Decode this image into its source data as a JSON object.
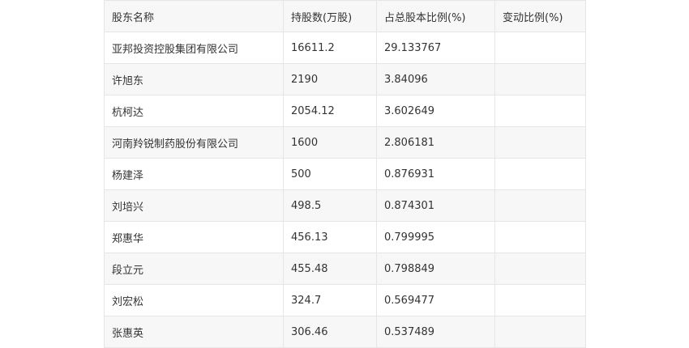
{
  "table": {
    "headers": [
      "股东名称",
      "持股数(万股)",
      "占总股本比例(%)",
      "变动比例(%)"
    ],
    "rows": [
      [
        "亚邦投资控股集团有限公司",
        "16611.2",
        "29.133767",
        ""
      ],
      [
        "许旭东",
        "2190",
        "3.84096",
        ""
      ],
      [
        "杭柯达",
        "2054.12",
        "3.602649",
        ""
      ],
      [
        "河南羚锐制药股份有限公司",
        "1600",
        "2.806181",
        ""
      ],
      [
        "杨建泽",
        "500",
        "0.876931",
        ""
      ],
      [
        "刘培兴",
        "498.5",
        "0.874301",
        ""
      ],
      [
        "郑惠华",
        "456.13",
        "0.799995",
        ""
      ],
      [
        "段立元",
        "455.48",
        "0.798849",
        ""
      ],
      [
        "刘宏松",
        "324.7",
        "0.569477",
        ""
      ],
      [
        "张惠英",
        "306.46",
        "0.537489",
        ""
      ]
    ]
  }
}
